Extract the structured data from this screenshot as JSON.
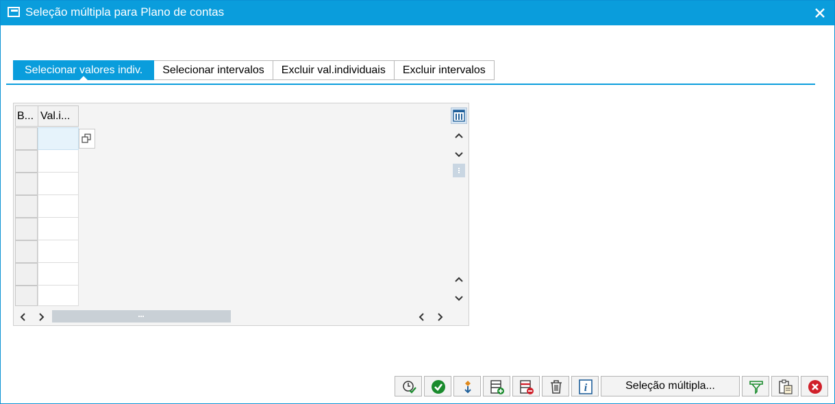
{
  "window": {
    "title": "Seleção múltipla para Plano de contas",
    "accent": "#0a9ddc"
  },
  "tabs": [
    {
      "label": "Selecionar valores indiv.",
      "active": true
    },
    {
      "label": "Selecionar intervalos",
      "active": false
    },
    {
      "label": "Excluir val.individuais",
      "active": false
    },
    {
      "label": "Excluir intervalos",
      "active": false
    }
  ],
  "grid": {
    "columns": [
      "B...",
      "Val.i..."
    ],
    "rows": [
      "",
      "",
      "",
      "",
      "",
      "",
      "",
      ""
    ]
  },
  "toolbar": {
    "icons": [
      "execute-clock-icon",
      "check-icon",
      "transfer-icon",
      "insert-line-icon",
      "delete-line-icon",
      "trash-icon",
      "info-icon",
      "filter-icon",
      "clipboard-icon",
      "cancel-icon"
    ],
    "multi_select_label": "Seleção múltipla..."
  }
}
